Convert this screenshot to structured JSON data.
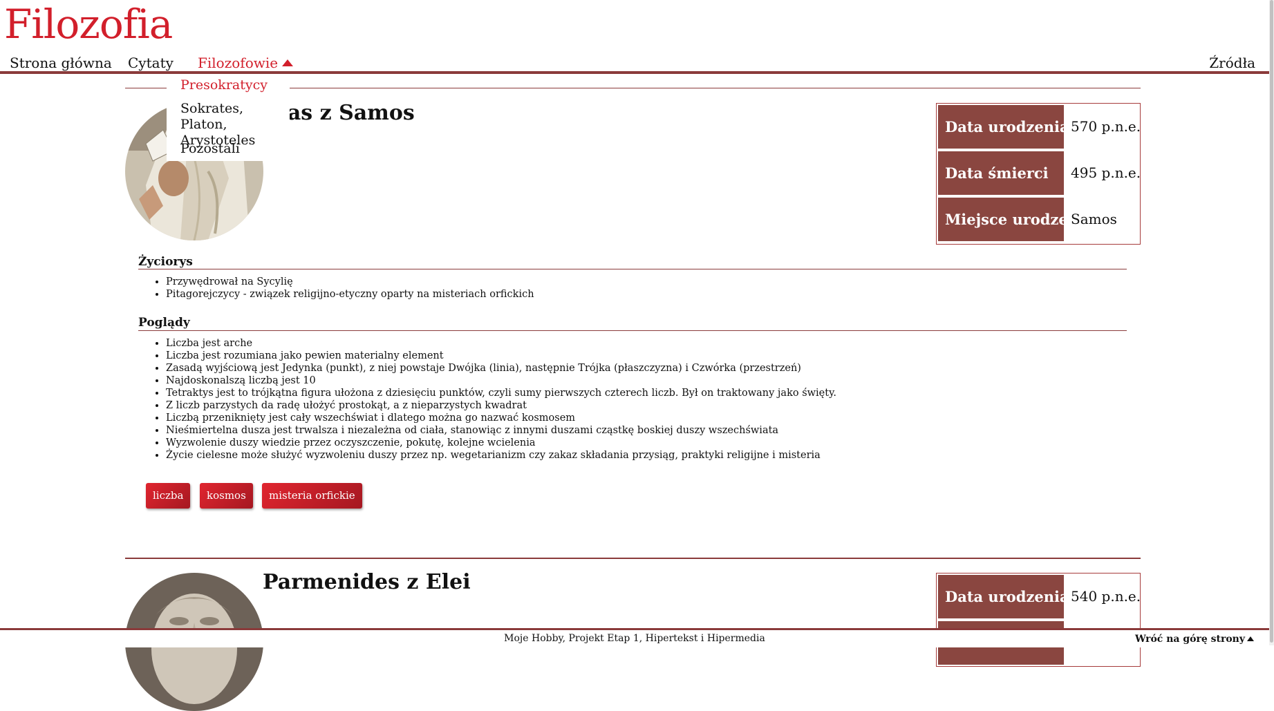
{
  "site": {
    "title": "Filozofia"
  },
  "nav": {
    "items": [
      {
        "label": "Strona główna"
      },
      {
        "label": "Cytaty"
      },
      {
        "label": "Filozofowie"
      }
    ],
    "right": "Źródła"
  },
  "dropdown": {
    "items": [
      {
        "label": "Presokratycy"
      },
      {
        "label": "Sokrates, Platon, Arystoteles"
      },
      {
        "label": "Pozostali"
      }
    ]
  },
  "philosophers": [
    {
      "name": "Pitagoras z Samos",
      "visible_name": "oras z Samos",
      "facts": [
        {
          "label": "Data urodzenia",
          "value": "570 p.n.e."
        },
        {
          "label": "Data śmierci",
          "value": "495 p.n.e."
        },
        {
          "label": "Miejsce urodzenia",
          "value": "Samos"
        }
      ],
      "bio_title": "Życiorys",
      "bio": [
        "Przywędrował na Sycylię",
        "Pitagorejczycy - związek religijno-etyczny oparty na misteriach orfickich"
      ],
      "views_title": "Poglądy",
      "views": [
        "Liczba jest arche",
        "Liczba jest rozumiana jako pewien materialny element",
        "Zasadą wyjściową jest Jedynka (punkt), z niej powstaje Dwójka (linia), następnie Trójka (płaszczyzna) i Czwórka (przestrzeń)",
        "Najdoskonalszą liczbą jest 10",
        "Tetraktys jest to trójkątna figura ułożona z dziesięciu punktów, czyli sumy pierwszych czterech liczb. Był on traktowany jako święty.",
        "Z liczb parzystych da radę ułożyć prostokąt, a z nieparzystych kwadrat",
        "Liczbą przeniknięty jest cały wszechświat i dlatego można go nazwać kosmosem",
        "Nieśmiertelna dusza jest trwalsza i niezależna od ciała, stanowiąc z innymi duszami cząstkę boskiej duszy wszechświata",
        "Wyzwolenie duszy wiedzie przez oczyszczenie, pokutę, kolejne wcielenia",
        "Życie cielesne może służyć wyzwoleniu duszy przez np. wegetarianizm czy zakaz składania przysiąg, praktyki religijne i misteria"
      ],
      "tags": [
        "liczba",
        "kosmos",
        "misteria orfickie"
      ]
    },
    {
      "name": "Parmenides z Elei",
      "facts": [
        {
          "label": "Data urodzenia",
          "value": "540 p.n.e."
        }
      ]
    }
  ],
  "footer": {
    "text": "Moje Hobby, Projekt Etap 1, Hipertekst i Hipermedia",
    "back_to_top": "Wróć na górę strony"
  },
  "colors": {
    "accent": "#d21f2b",
    "brown": "#8a4640"
  }
}
